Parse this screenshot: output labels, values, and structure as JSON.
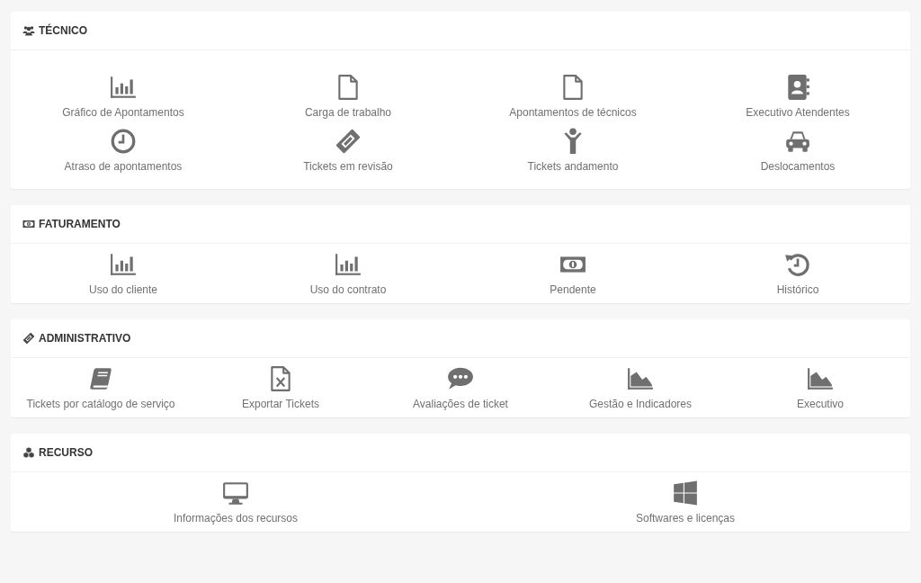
{
  "sections": [
    {
      "title": "TÉCNICO",
      "kind": "users",
      "items": [
        {
          "label": "Gráfico de Apontamentos",
          "kind": "bar-chart"
        },
        {
          "label": "Carga de trabalho",
          "kind": "file"
        },
        {
          "label": "Apontamentos de técnicos",
          "kind": "file"
        },
        {
          "label": "Executivo Atendentes",
          "kind": "address-book"
        },
        {
          "label": "Atraso de apontamentos",
          "kind": "clock"
        },
        {
          "label": "Tickets em revisão",
          "kind": "ticket"
        },
        {
          "label": "Tickets andamento",
          "kind": "child"
        },
        {
          "label": "Deslocamentos",
          "kind": "car"
        }
      ]
    },
    {
      "title": "FATURAMENTO",
      "kind": "money",
      "items": [
        {
          "label": "Uso do cliente",
          "kind": "bar-chart"
        },
        {
          "label": "Uso do contrato",
          "kind": "bar-chart"
        },
        {
          "label": "Pendente",
          "kind": "money"
        },
        {
          "label": "Histórico",
          "kind": "history"
        }
      ]
    },
    {
      "title": "ADMINISTRATIVO",
      "kind": "ticket",
      "items": [
        {
          "label": "Tickets por catálogo de serviço",
          "kind": "book"
        },
        {
          "label": "Exportar Tickets",
          "kind": "file-excel"
        },
        {
          "label": "Avaliações de ticket",
          "kind": "comment"
        },
        {
          "label": "Gestão e Indicadores",
          "kind": "area-chart"
        },
        {
          "label": "Executivo",
          "kind": "area-chart"
        }
      ]
    },
    {
      "title": "RECURSO",
      "kind": "cubes",
      "items": [
        {
          "label": "Informações dos recursos",
          "kind": "desktop"
        },
        {
          "label": "Softwares e licenças",
          "kind": "windows"
        }
      ]
    }
  ]
}
